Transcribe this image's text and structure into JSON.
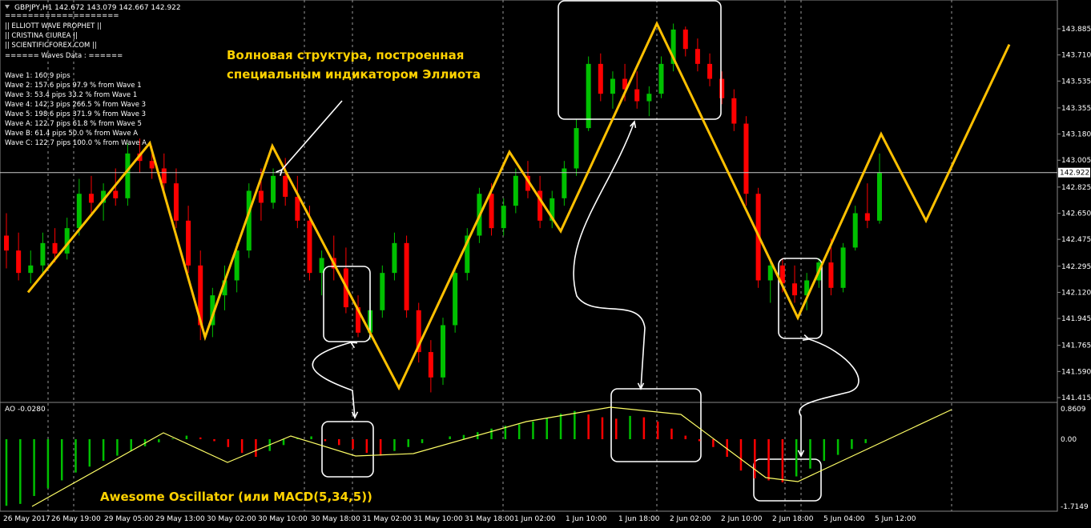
{
  "header": {
    "symbol_line": "GBPJPY,H1  142.672 143.079 142.667 142.922"
  },
  "info_panel": {
    "lines": [
      "====================",
      "||   ELLIOTT WAVE PROPHET   ||",
      "||       CRISTINA CIUREA        ||",
      "||    SCIENTIFICFOREX.COM    ||",
      "====== Waves Data : ======",
      "",
      "Wave 1: 160.9 pips",
      "Wave 2: 157.6 pips 97.9 % from Wave 1",
      "Wave 3: 53.4 pips 33.2 % from Wave 1",
      "Wave 4: 142.3 pips 266.5 % from Wave 3",
      "Wave 5: 198.6 pips 371.9 % from Wave 3",
      "Wave A: 122.7 pips 61.8 % from Wave 5",
      "Wave B: 61.4 pips 50.0 % from Wave A",
      "Wave C: 122.7 pips 100.0 % from Wave A"
    ]
  },
  "annotations": {
    "wave_title_line1": "Волновая структура, построенная",
    "wave_title_line2": "специальным индикатором Эллиота",
    "ao_title": "Awesome Oscillator (или MACD(5,34,5))"
  },
  "colors": {
    "background": "#000000",
    "bull_candle": "#00c000",
    "bear_candle": "#ff0000",
    "wave_line": "#ffc000",
    "ao_line": "#ffff66",
    "grid_vertical": "#ffffff",
    "annotation_text": "#ffd200"
  },
  "chart_data": [
    {
      "type": "candlestick",
      "title": "GBPJPY,H1",
      "ohlc_header": {
        "open": 142.672,
        "high": 143.079,
        "low": 142.667,
        "close": 142.922
      },
      "current_price": 142.922,
      "ylim": [
        141.415,
        144.0
      ],
      "y_ticks": [
        "143.885",
        "143.710",
        "143.535",
        "143.355",
        "143.180",
        "143.005",
        "142.825",
        "142.650",
        "142.475",
        "142.295",
        "142.120",
        "141.945",
        "141.765",
        "141.590",
        "141.415"
      ],
      "x_ticks": [
        "26 May 2017",
        "26 May 19:00",
        "29 May 05:00",
        "29 May 13:00",
        "30 May 02:00",
        "30 May 10:00",
        "30 May 18:00",
        "31 May 02:00",
        "31 May 10:00",
        "31 May 18:00",
        "1 Jun 02:00",
        "1 Jun 10:00",
        "1 Jun 18:00",
        "2 Jun 02:00",
        "2 Jun 10:00",
        "2 Jun 18:00",
        "5 Jun 04:00",
        "5 Jun 12:00"
      ],
      "candles": [
        [
          142.5,
          142.65,
          142.28,
          142.4
        ],
        [
          142.4,
          142.52,
          142.2,
          142.25
        ],
        [
          142.25,
          142.4,
          142.18,
          142.3
        ],
        [
          142.3,
          142.52,
          142.25,
          142.45
        ],
        [
          142.45,
          142.55,
          142.32,
          142.38
        ],
        [
          142.38,
          142.62,
          142.34,
          142.55
        ],
        [
          142.55,
          142.88,
          142.5,
          142.78
        ],
        [
          142.78,
          142.9,
          142.65,
          142.72
        ],
        [
          142.72,
          142.85,
          142.6,
          142.8
        ],
        [
          142.8,
          142.95,
          142.7,
          142.75
        ],
        [
          142.75,
          143.12,
          142.7,
          143.05
        ],
        [
          143.05,
          143.15,
          142.92,
          143.0
        ],
        [
          143.0,
          143.1,
          142.88,
          142.95
        ],
        [
          142.95,
          143.05,
          142.8,
          142.85
        ],
        [
          142.85,
          142.95,
          142.55,
          142.6
        ],
        [
          142.6,
          142.7,
          142.25,
          142.3
        ],
        [
          142.3,
          142.4,
          141.8,
          141.9
        ],
        [
          141.9,
          142.15,
          141.82,
          142.1
        ],
        [
          142.1,
          142.3,
          142.0,
          142.2
        ],
        [
          142.2,
          142.45,
          142.12,
          142.4
        ],
        [
          142.4,
          142.85,
          142.35,
          142.8
        ],
        [
          142.8,
          142.95,
          142.6,
          142.72
        ],
        [
          142.72,
          142.95,
          142.68,
          142.9
        ],
        [
          142.9,
          143.02,
          142.7,
          142.76
        ],
        [
          142.76,
          142.9,
          142.55,
          142.6
        ],
        [
          142.6,
          142.7,
          142.2,
          142.25
        ],
        [
          142.25,
          142.4,
          142.1,
          142.35
        ],
        [
          142.35,
          142.5,
          142.2,
          142.28
        ],
        [
          142.28,
          142.42,
          141.98,
          142.02
        ],
        [
          142.02,
          142.1,
          141.82,
          141.85
        ],
        [
          141.85,
          142.05,
          141.8,
          142.0
        ],
        [
          142.0,
          142.3,
          141.95,
          142.25
        ],
        [
          142.25,
          142.52,
          142.2,
          142.45
        ],
        [
          142.45,
          142.5,
          141.95,
          142.0
        ],
        [
          142.0,
          142.05,
          141.65,
          141.72
        ],
        [
          141.72,
          141.8,
          141.45,
          141.55
        ],
        [
          141.55,
          141.95,
          141.5,
          141.9
        ],
        [
          141.9,
          142.3,
          141.85,
          142.25
        ],
        [
          142.25,
          142.55,
          142.2,
          142.5
        ],
        [
          142.5,
          142.82,
          142.45,
          142.78
        ],
        [
          142.78,
          142.85,
          142.5,
          142.55
        ],
        [
          142.55,
          142.75,
          142.5,
          142.7
        ],
        [
          142.7,
          142.95,
          142.65,
          142.9
        ],
        [
          142.9,
          143.0,
          142.75,
          142.8
        ],
        [
          142.8,
          142.9,
          142.55,
          142.6
        ],
        [
          142.6,
          142.8,
          142.55,
          142.75
        ],
        [
          142.75,
          143.0,
          142.7,
          142.95
        ],
        [
          142.95,
          143.28,
          142.9,
          143.22
        ],
        [
          143.22,
          143.7,
          143.2,
          143.65
        ],
        [
          143.65,
          143.72,
          143.4,
          143.45
        ],
        [
          143.45,
          143.6,
          143.35,
          143.55
        ],
        [
          143.55,
          143.65,
          143.4,
          143.48
        ],
        [
          143.48,
          143.6,
          143.35,
          143.4
        ],
        [
          143.4,
          143.5,
          143.3,
          143.45
        ],
        [
          143.45,
          143.7,
          143.42,
          143.65
        ],
        [
          143.65,
          143.92,
          143.6,
          143.88
        ],
        [
          143.88,
          143.9,
          143.7,
          143.75
        ],
        [
          143.75,
          143.82,
          143.6,
          143.65
        ],
        [
          143.65,
          143.72,
          143.5,
          143.55
        ],
        [
          143.55,
          143.6,
          143.38,
          143.42
        ],
        [
          143.42,
          143.48,
          143.2,
          143.25
        ],
        [
          143.25,
          143.3,
          142.7,
          142.78
        ],
        [
          142.78,
          142.82,
          142.15,
          142.2
        ],
        [
          142.2,
          142.35,
          142.05,
          142.3
        ],
        [
          142.3,
          142.35,
          142.12,
          142.18
        ],
        [
          142.18,
          142.3,
          142.05,
          142.1
        ],
        [
          142.1,
          142.25,
          142.0,
          142.2
        ],
        [
          142.2,
          142.35,
          142.15,
          142.32
        ],
        [
          142.32,
          142.48,
          142.1,
          142.15
        ],
        [
          142.15,
          142.45,
          142.12,
          142.42
        ],
        [
          142.42,
          142.7,
          142.4,
          142.65
        ],
        [
          142.65,
          142.85,
          142.55,
          142.6
        ],
        [
          142.6,
          143.05,
          142.58,
          142.92
        ]
      ]
    },
    {
      "type": "line",
      "name": "Elliott wave structure",
      "x": [
        "26 May 2017",
        "26 May 19:00",
        "29 May 05:00",
        "29 May 13:00",
        "30 May 02:00",
        "30 May 10:00",
        "31 May 02:00",
        "31 May 10:00",
        "1 Jun 02:00",
        "1 Jun 10:00",
        "1 Jun 18:00",
        "2 Jun 02:00",
        "2 Jun 10:00",
        "2 Jun 18:00",
        "5 Jun 04:00",
        "5 Jun 12:00"
      ],
      "values": [
        142.12,
        143.12,
        141.82,
        143.1,
        141.48,
        143.06,
        142.53,
        143.92,
        141.95,
        143.18,
        142.6,
        143.78
      ]
    },
    {
      "type": "bar",
      "title": "AO -0.0280",
      "ylim": [
        -1.7149,
        0.8609
      ],
      "y_ticks": [
        "0.8609",
        "0.00",
        "-1.7149"
      ],
      "values": [
        -1.7,
        -1.65,
        -1.45,
        -1.25,
        -1.05,
        -0.85,
        -0.7,
        -0.55,
        -0.42,
        -0.3,
        -0.18,
        -0.08,
        0.02,
        0.1,
        0.05,
        -0.05,
        -0.2,
        -0.35,
        -0.45,
        -0.3,
        -0.15,
        0.02,
        0.08,
        -0.05,
        -0.15,
        -0.25,
        -0.35,
        -0.42,
        -0.3,
        -0.2,
        -0.1,
        0.0,
        0.08,
        0.12,
        0.2,
        0.3,
        0.38,
        0.42,
        0.5,
        0.6,
        0.72,
        0.8,
        0.7,
        0.62,
        0.58,
        0.66,
        0.62,
        0.5,
        0.3,
        0.1,
        -0.05,
        -0.2,
        -0.45,
        -0.8,
        -1.0,
        -1.05,
        -1.1,
        -0.95,
        -0.75,
        -0.55,
        -0.4,
        -0.25,
        -0.1,
        0.0
      ]
    }
  ]
}
